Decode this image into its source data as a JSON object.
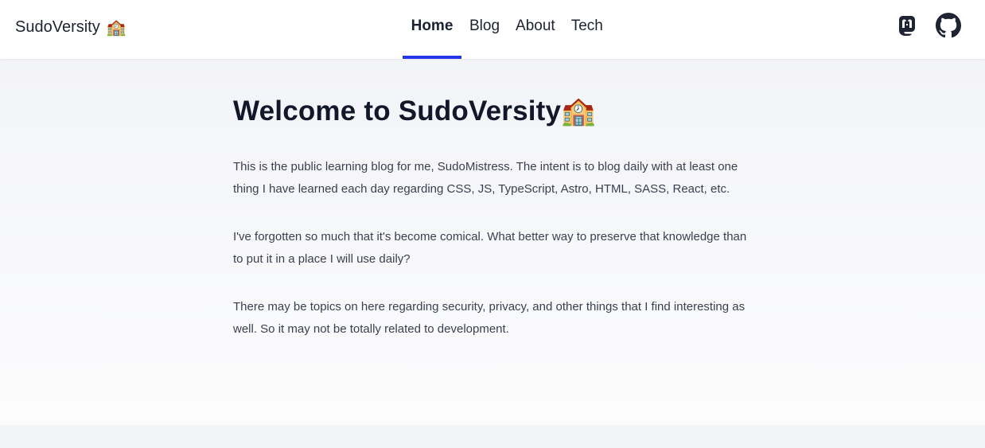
{
  "header": {
    "brand": "SudoVersity",
    "brand_emoji": "🏫",
    "nav": [
      {
        "label": "Home",
        "active": true
      },
      {
        "label": "Blog",
        "active": false
      },
      {
        "label": "About",
        "active": false
      },
      {
        "label": "Tech",
        "active": false
      }
    ],
    "social_icons": [
      "mastodon-icon",
      "github-icon"
    ],
    "accent_color": "#2536ec"
  },
  "main": {
    "title": "Welcome to SudoVersity",
    "title_emoji": "🏫",
    "paragraphs": [
      "This is the public learning blog for me, SudoMistress. The intent is to blog daily with at least one thing I have learned each day regarding CSS, JS, TypeScript, Astro, HTML, SASS, React, etc.",
      "I've forgotten so much that it's become comical. What better way to preserve that knowledge than to put it in a place I will use daily?",
      "There may be topics on here regarding security, privacy, and other things that I find interesting as well. So it may not be totally related to development."
    ]
  }
}
